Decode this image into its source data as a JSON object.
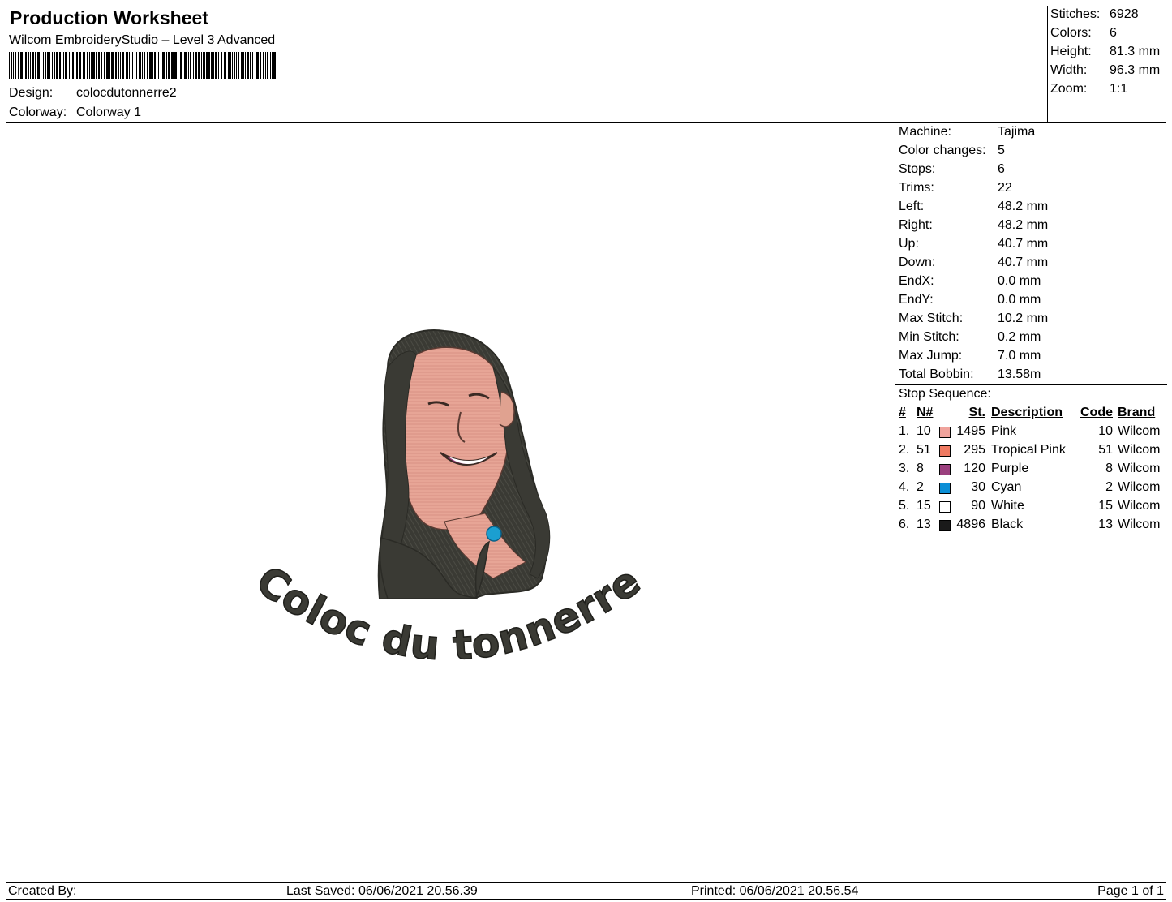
{
  "header": {
    "title": "Production Worksheet",
    "subtitle": "Wilcom EmbroideryStudio – Level 3 Advanced",
    "design_label": "Design:",
    "design_value": "colocdutonnerre2",
    "colorway_label": "Colorway:",
    "colorway_value": "Colorway 1"
  },
  "summary": {
    "stitches_label": "Stitches:",
    "stitches": "6928",
    "colors_label": "Colors:",
    "colors": "6",
    "height_label": "Height:",
    "height": "81.3 mm",
    "width_label": "Width:",
    "width": "96.3 mm",
    "zoom_label": "Zoom:",
    "zoom": "1:1"
  },
  "machine_info": [
    {
      "label": "Machine:",
      "value": "Tajima"
    },
    {
      "label": "Color changes:",
      "value": "5"
    },
    {
      "label": "Stops:",
      "value": "6"
    },
    {
      "label": "Trims:",
      "value": "22"
    },
    {
      "label": "Left:",
      "value": "48.2 mm"
    },
    {
      "label": "Right:",
      "value": "48.2 mm"
    },
    {
      "label": "Up:",
      "value": "40.7 mm"
    },
    {
      "label": "Down:",
      "value": "40.7 mm"
    },
    {
      "label": "EndX:",
      "value": "0.0 mm"
    },
    {
      "label": "EndY:",
      "value": "0.0 mm"
    },
    {
      "label": "Max Stitch:",
      "value": "10.2 mm"
    },
    {
      "label": "Min Stitch:",
      "value": "0.2 mm"
    },
    {
      "label": "Max Jump:",
      "value": "7.0 mm"
    },
    {
      "label": "Total Bobbin:",
      "value": "13.58m"
    }
  ],
  "stop_sequence": {
    "label": "Stop Sequence:",
    "headers": {
      "num": "#",
      "n": "N#",
      "st": "St.",
      "desc": "Description",
      "code": "Code",
      "brand": "Brand"
    },
    "rows": [
      {
        "num": "1.",
        "n": "10",
        "st": "1495",
        "desc": "Pink",
        "code": "10",
        "brand": "Wilcom",
        "color": "#f0a39c"
      },
      {
        "num": "2.",
        "n": "51",
        "st": "295",
        "desc": "Tropical Pink",
        "code": "51",
        "brand": "Wilcom",
        "color": "#ef7a62"
      },
      {
        "num": "3.",
        "n": "8",
        "st": "120",
        "desc": "Purple",
        "code": "8",
        "brand": "Wilcom",
        "color": "#9b3f7e"
      },
      {
        "num": "4.",
        "n": "2",
        "st": "30",
        "desc": "Cyan",
        "code": "2",
        "brand": "Wilcom",
        "color": "#0b8fd6"
      },
      {
        "num": "5.",
        "n": "15",
        "st": "90",
        "desc": "White",
        "code": "15",
        "brand": "Wilcom",
        "color": "#ffffff"
      },
      {
        "num": "6.",
        "n": "13",
        "st": "4896",
        "desc": "Black",
        "code": "13",
        "brand": "Wilcom",
        "color": "#1a1a1a"
      }
    ]
  },
  "design_preview": {
    "text": "Coloc du tonnerre",
    "thread_dark": "#3a3a34",
    "thread_skin": "#e7a596",
    "thread_lip": "#9b3f7e",
    "thread_pendant": "#1b9fd0"
  },
  "footer": {
    "created_by": "Created By:",
    "last_saved": "Last Saved: 06/06/2021 20.56.39",
    "printed": "Printed: 06/06/2021 20.56.54",
    "page": "Page 1 of 1"
  }
}
